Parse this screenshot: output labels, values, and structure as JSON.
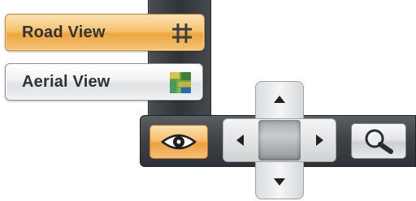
{
  "map_style": {
    "road_label": "Road View",
    "aerial_label": "Aerial View",
    "selected": "Road View",
    "road_icon": "road-grid-icon",
    "aerial_icon": "aerial-tile-icon"
  },
  "navigation": {
    "eye_icon": "eye-icon",
    "up_icon": "arrow-up-icon",
    "down_icon": "arrow-down-icon",
    "left_icon": "arrow-left-icon",
    "right_icon": "arrow-right-icon",
    "zoom_icon": "magnifier-icon"
  },
  "colors": {
    "selected_accent": "#f0a53c",
    "rail_dark": "#33383c"
  }
}
